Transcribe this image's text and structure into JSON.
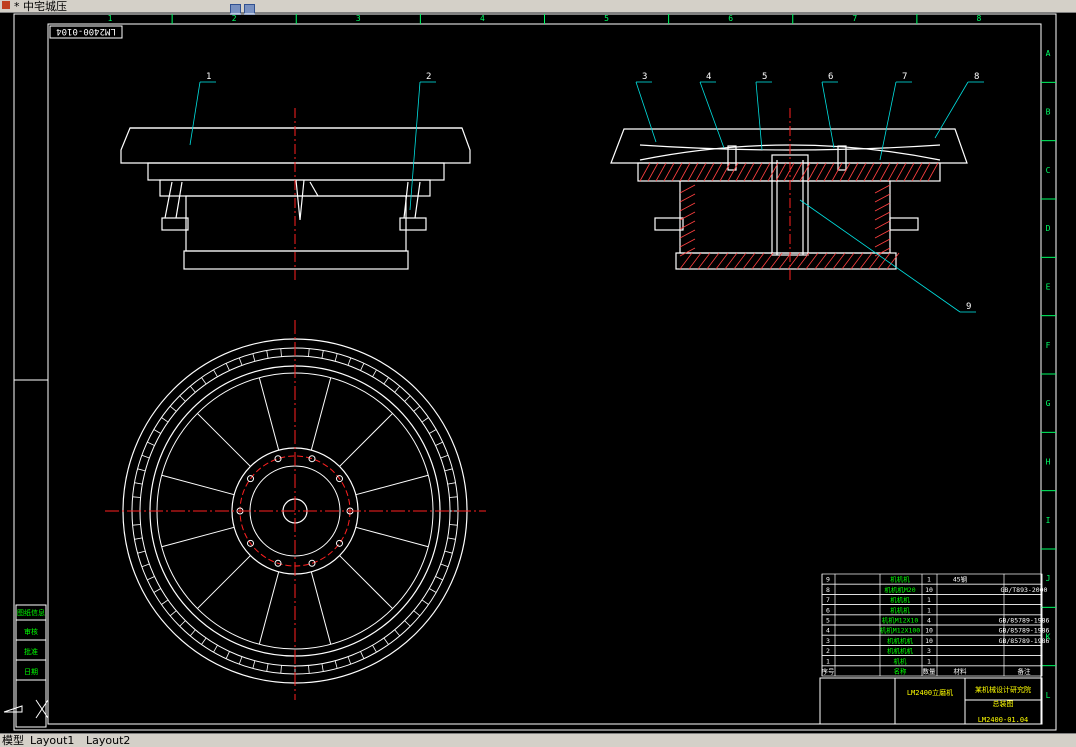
{
  "window": {
    "title": "* 中宅城压"
  },
  "tabs": [
    {
      "label": "模型"
    },
    {
      "label": "Layout1"
    },
    {
      "label": "Layout2"
    }
  ],
  "drawing": {
    "column_labels": [
      "1",
      "2",
      "3",
      "4",
      "5",
      "6",
      "7",
      "8"
    ],
    "row_labels": [
      "A",
      "B",
      "C",
      "D",
      "E",
      "F",
      "G",
      "H",
      "I",
      "J",
      "K",
      "L"
    ],
    "drawing_no_stamp": "LM2400-0104",
    "part_callouts": [
      "1",
      "2",
      "3",
      "4",
      "5",
      "6",
      "7",
      "8",
      "9"
    ],
    "colors": {
      "frame": "#ffffff",
      "grid": "#00ff66",
      "centerline": "#ff2020",
      "callout": "#00e0e0",
      "hatch": "#ff4040",
      "green_text": "#00ff00",
      "yellow_text": "#ffff00"
    }
  },
  "bom": {
    "rows": [
      {
        "no": "9",
        "name": "机机机",
        "qty": "1",
        "material": "45钢",
        "std": ""
      },
      {
        "no": "8",
        "name": "机机机M20",
        "qty": "10",
        "material": "",
        "std": "GB/T893-2000"
      },
      {
        "no": "7",
        "name": "机机机",
        "qty": "1",
        "material": "",
        "std": ""
      },
      {
        "no": "6",
        "name": "机机机",
        "qty": "1",
        "material": "",
        "std": ""
      },
      {
        "no": "5",
        "name": "机机M12X10",
        "qty": "4",
        "material": "",
        "std": "GB/85789-1986"
      },
      {
        "no": "4",
        "name": "机机M12X100",
        "qty": "10",
        "material": "",
        "std": "GB/85789-1986"
      },
      {
        "no": "3",
        "name": "机机机机",
        "qty": "10",
        "material": "",
        "std": "GB/85789-1986"
      },
      {
        "no": "2",
        "name": "机机机机",
        "qty": "3",
        "material": "",
        "std": ""
      },
      {
        "no": "1",
        "name": "机机",
        "qty": "1",
        "material": "",
        "std": ""
      }
    ],
    "header": [
      "序号",
      "名称",
      "数量",
      "材料",
      "备注"
    ],
    "title_block": {
      "project": "LM2400立磨机",
      "company": "某机械设计研究院",
      "drawing_title": "总装图",
      "drawing_no": "LM2400-01.04"
    }
  },
  "left_strip": {
    "labels": [
      "图纸信息",
      "审核",
      "批准",
      "日期"
    ]
  }
}
